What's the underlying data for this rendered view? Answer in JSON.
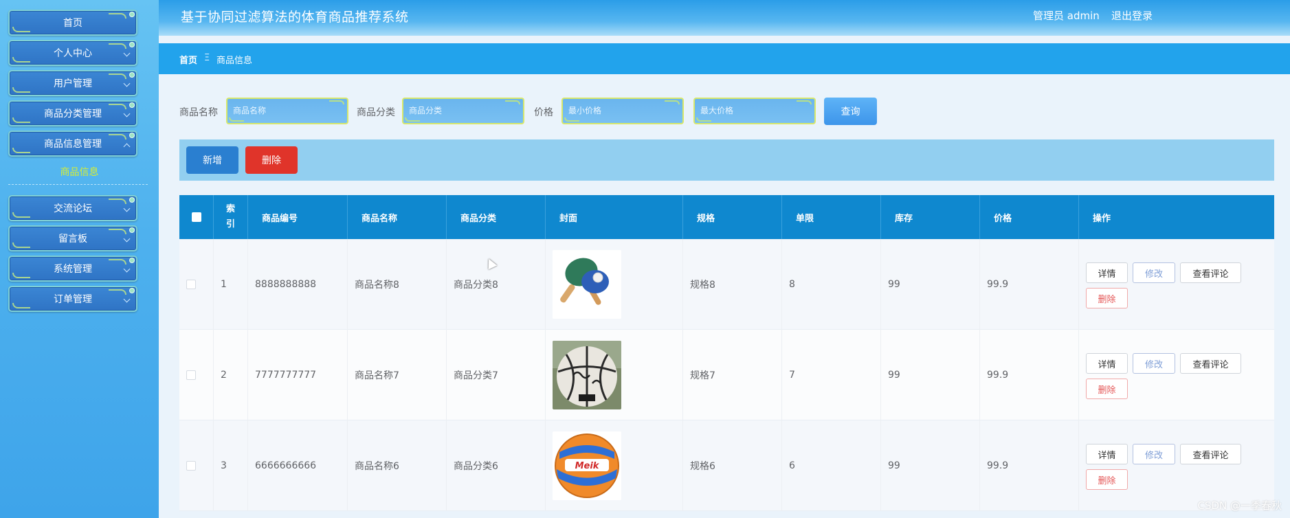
{
  "app": {
    "title": "基于协同过滤算法的体育商品推荐系统",
    "user_label": "管理员 admin",
    "logout_label": "退出登录"
  },
  "sidebar": {
    "items": [
      {
        "label": "首页"
      },
      {
        "label": "个人中心"
      },
      {
        "label": "用户管理"
      },
      {
        "label": "商品分类管理"
      },
      {
        "label": "商品信息管理"
      },
      {
        "label": "交流论坛"
      },
      {
        "label": "留言板"
      },
      {
        "label": "系统管理"
      },
      {
        "label": "订单管理"
      }
    ],
    "active_submenu": "商品信息"
  },
  "breadcrumb": {
    "home": "首页",
    "separator": "Ξ",
    "current": "商品信息"
  },
  "search": {
    "name_label": "商品名称",
    "name_placeholder": "商品名称",
    "category_label": "商品分类",
    "category_placeholder": "商品分类",
    "price_label": "价格",
    "price_min_placeholder": "最小价格",
    "price_max_placeholder": "最大价格",
    "query_label": "查询"
  },
  "actions": {
    "add_label": "新增",
    "delete_label": "删除"
  },
  "table": {
    "headers": {
      "index": "索引",
      "code": "商品编号",
      "name": "商品名称",
      "category": "商品分类",
      "cover": "封面",
      "spec": "规格",
      "limit": "单限",
      "stock": "库存",
      "price": "价格",
      "ops": "操作"
    },
    "rows": [
      {
        "index": "1",
        "code": "8888888888",
        "name": "商品名称8",
        "category": "商品分类8",
        "cover": "table-tennis-paddles",
        "spec": "规格8",
        "limit": "8",
        "stock": "99",
        "price": "99.9"
      },
      {
        "index": "2",
        "code": "7777777777",
        "name": "商品名称7",
        "category": "商品分类7",
        "cover": "basketball",
        "spec": "规格7",
        "limit": "7",
        "stock": "99",
        "price": "99.9"
      },
      {
        "index": "3",
        "code": "6666666666",
        "name": "商品名称6",
        "category": "商品分类6",
        "cover": "volleyball",
        "spec": "规格6",
        "limit": "6",
        "stock": "99",
        "price": "99.9"
      }
    ],
    "row_actions": {
      "detail": "详情",
      "edit": "修改",
      "reviews": "查看评论",
      "delete": "删除"
    }
  },
  "watermark": "CSDN @一季春秋",
  "colors": {
    "sidebar": "#4eb1ee",
    "menu_button": "#2f74c5",
    "submenu_active": "#d7ee33",
    "breadcrumb_bar": "#22a3ec",
    "table_header": "#0f88cf",
    "add_button": "#2a7fd0",
    "delete_button": "#e0342a"
  }
}
